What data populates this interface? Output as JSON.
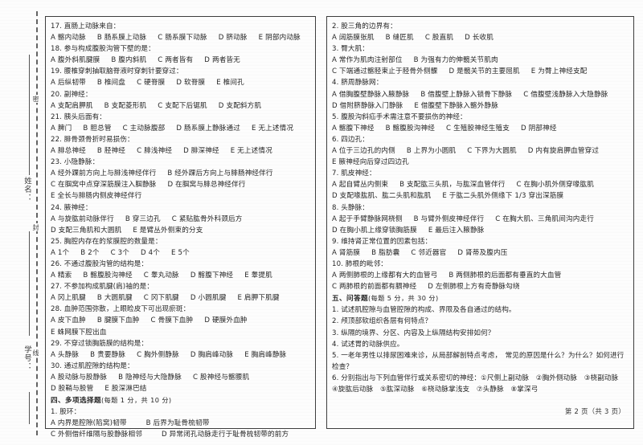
{
  "margin": {
    "name_label": "姓名：",
    "id_label": "学号：",
    "seal_chars": [
      "密",
      "封",
      "线"
    ]
  },
  "footer": {
    "text": "第 2 页（共 3 页）"
  },
  "left_column": {
    "questions": [
      {
        "num": "17.",
        "stem": "直肠上动脉来自：",
        "options": [
          "A 髂内动脉",
          "B 肠系膜上动脉",
          "C 肠系膜下动脉",
          "D 脐动脉",
          "E 阴部内动脉"
        ]
      },
      {
        "num": "18.",
        "stem": "参与构成腹股沟管下壁的是：",
        "options": [
          "A 腹外斜肌腱膜",
          "B 腹内斜肌",
          "C 两者皆有",
          "D 两者皆无"
        ]
      },
      {
        "num": "19.",
        "stem": "腰椎穿刺抽取脑脊液时穿刺针要穿过：",
        "options": [
          "A 后纵韧带",
          "B 椎间盘",
          "C 硬脊膜",
          "D 软脊膜",
          "E 椎间孔"
        ]
      },
      {
        "num": "20.",
        "stem": "副神经：",
        "options": [
          "A 支配肩胛肌",
          "B 支配菱形肌",
          "C 支配下后锯肌",
          "D 支配斜方肌"
        ]
      },
      {
        "num": "21.",
        "stem": "胰头后面有：",
        "options": [
          "A 脾门",
          "B 胆总管",
          "C 主动脉腹部",
          "D 肠系膜上静脉通过",
          "E 无上述情况"
        ]
      },
      {
        "num": "22.",
        "stem": "腓骨颈骨折时易损伤：",
        "options": [
          "A 腓总神经",
          "B 胫神经",
          "C 腓浅神经",
          "D 腓深神经",
          "E 无上述情况"
        ]
      },
      {
        "num": "23.",
        "stem": "小隐静脉：",
        "options": [
          "A 经外踝前方向上与腓浅神经伴行",
          "B 经外踝后方向上与腓肠神经伴行",
          "C 在腘窝中点穿深筋膜注入腘静脉",
          "D 在腘窝与腓总神经伴行",
          "E 全长与腓肠内侧皮神经伴行"
        ]
      },
      {
        "num": "24.",
        "stem": "腋神经：",
        "options": [
          "A 与旋肱前动脉伴行",
          "B 穿三边孔",
          "C 紧贴肱骨外科颈后方",
          "D 支配三角肌和大圆肌",
          "E 是臂丛外侧束的分支"
        ]
      },
      {
        "num": "25.",
        "stem": "胸腔内存在的浆膜腔的数量是：",
        "options": [
          "A 1个",
          "B 2个",
          "C 3个",
          "D 4个",
          "E 5个"
        ]
      },
      {
        "num": "26.",
        "stem": "不通过腹股沟管的结构是：",
        "options": [
          "A 精索",
          "B 髂腹股沟神经",
          "C 睾丸动脉",
          "D 髂腹下神经",
          "E 睾提肌"
        ]
      },
      {
        "num": "27.",
        "stem": "不参加构成肌腱(肩)袖的是：",
        "options": [
          "A 冈上肌腱",
          "B 大圆肌腱",
          "C 冈下肌腱",
          "D 小圆肌腱",
          "E 肩胛下肌腱"
        ]
      },
      {
        "num": "28.",
        "stem": "血肿范围弥散，上眼睑皮下可出现瘀斑：",
        "options": [
          "A 皮下血肿",
          "B 腱膜下血肿",
          "C 骨膜下血肿",
          "D 硬膜外血肿",
          "E 蛛网膜下腔出血"
        ]
      },
      {
        "num": "29.",
        "stem": "不穿过锁胸筋膜的结构是：",
        "options": [
          "A 头静脉",
          "B 贵要静脉",
          "C 胸外侧静脉",
          "D 胸肩峰动脉",
          "E 胸肩峰静脉"
        ]
      },
      {
        "num": "30.",
        "stem": "通过肌腔隙的结构是：",
        "options": [
          "A 股动脉与股静脉",
          "B 隐神经与大隐静脉",
          "C 股神经与髂腰肌",
          "D 股鞘与股管",
          "E 股深淋巴结"
        ]
      }
    ],
    "section": {
      "title": "四、多项选择题",
      "scoring": "(每题 1 分，共 10 分)"
    },
    "multi_questions": [
      {
        "num": "1.",
        "stem": "股环：",
        "options": [
          "A 内界是腔隙(陷窝)韧带",
          "B 后界为耻骨梳韧带",
          "C 外侧借纤维隔与股静脉相邻",
          "D 异常闭孔动脉走行于耻骨梳韧带的前方"
        ]
      }
    ]
  },
  "right_column": {
    "multi_questions": [
      {
        "num": "2.",
        "stem": "股三角的边界有：",
        "options": [
          "A 阔筋膜张肌",
          "B 缝匠肌",
          "C 股直肌",
          "D 长收肌"
        ]
      },
      {
        "num": "3.",
        "stem": "臀大肌：",
        "options": [
          "A 常作为肌肉注射部位",
          "B 为强有力的伸髋关节肌肉",
          "C 下端通过髂胫束止于胫骨外侧髁",
          "D 是髋关节的主要屈肌",
          "E 为臀上神经支配"
        ]
      },
      {
        "num": "4.",
        "stem": "脐周静脉网：",
        "options": [
          "A 借胸腹壁静脉入腋静脉",
          "B 借腹壁上静脉入锁骨下静脉",
          "C 借腹壁浅静脉入大隐静脉",
          "D 借附脐静脉入门静脉",
          "E 借腹壁下静脉入髂外静脉"
        ]
      },
      {
        "num": "5.",
        "stem": "腹股沟斜疝手术需注意不要损伤的神经：",
        "options": [
          "A 髂腹下神经",
          "B 髂腹股沟神经",
          "C 生殖股神经生殖支",
          "D 阴部神经"
        ]
      },
      {
        "num": "6.",
        "stem": "四边孔：",
        "options": [
          "A 位于三边孔的内侧",
          "B 上界为小圆肌",
          "C 下界为大圆肌",
          "D 内有旋肩胛血管穿过",
          "E 腋神经向后穿过四边孔"
        ]
      },
      {
        "num": "7.",
        "stem": "肌皮神经：",
        "options": [
          "A 起自臂丛内侧束",
          "B 支配肱三头肌，与肱深血管伴行",
          "C 在胸小肌外侧穿喙肱肌",
          "D 支配喙肱肌、肱二头肌和肱肌",
          "E 于肱二头肌外侧缘下 1/3 穿出深筋膜"
        ]
      },
      {
        "num": "8.",
        "stem": "头静脉：",
        "options": [
          "A 起于手臂静脉网桡侧",
          "B 与臂外侧皮神经伴行",
          "C 在胸大肌、三角肌间沟内走行",
          "D 在胸小肌上缘穿锁胸筋膜",
          "E 最后注入腋静脉"
        ]
      },
      {
        "num": "9.",
        "stem": "维持肾正常位置的因素包括：",
        "options": [
          "A 肾筋膜",
          "B 脂肪囊",
          "C 邻近器官",
          "D 肾蒂及腹内压"
        ]
      },
      {
        "num": "10.",
        "stem": "肺根的毗邻：",
        "options": [
          "A 两侧肺根的上缘都有大的血管弓",
          "B 两侧肺根的后面都有垂直的大血管",
          "C 两肺根的前面都有膈神经",
          "D 左侧肺根上方有奇静脉勾绕"
        ]
      }
    ],
    "section": {
      "title": "五、问答题",
      "scoring": "(每题 5 分，共 30 分)"
    },
    "essay_questions": [
      "1. 试述肌腔隙与血管腔隙的构成、界限及各自通过的结构。",
      "2. 颅顶部软组织各层有何特点？",
      "3. 纵隔的境界、分区、内容及上纵隔结构安排如何？",
      "4. 试述胃的动脉供应。",
      "5. 一老年男性以排尿困难来诊，从局部解剖特点考虑，　常见的原因是什么？为什么？如何进行检查？",
      "6. 分别指出与下列血管伴行或关系密切的神经：①尺侧上副动脉　②胸外侧动脉　③桡副动脉　④旋肱后动脉　⑤肱深动脉　⑥桡动脉掌浅支　⑦头静脉　⑧掌深弓"
    ]
  }
}
